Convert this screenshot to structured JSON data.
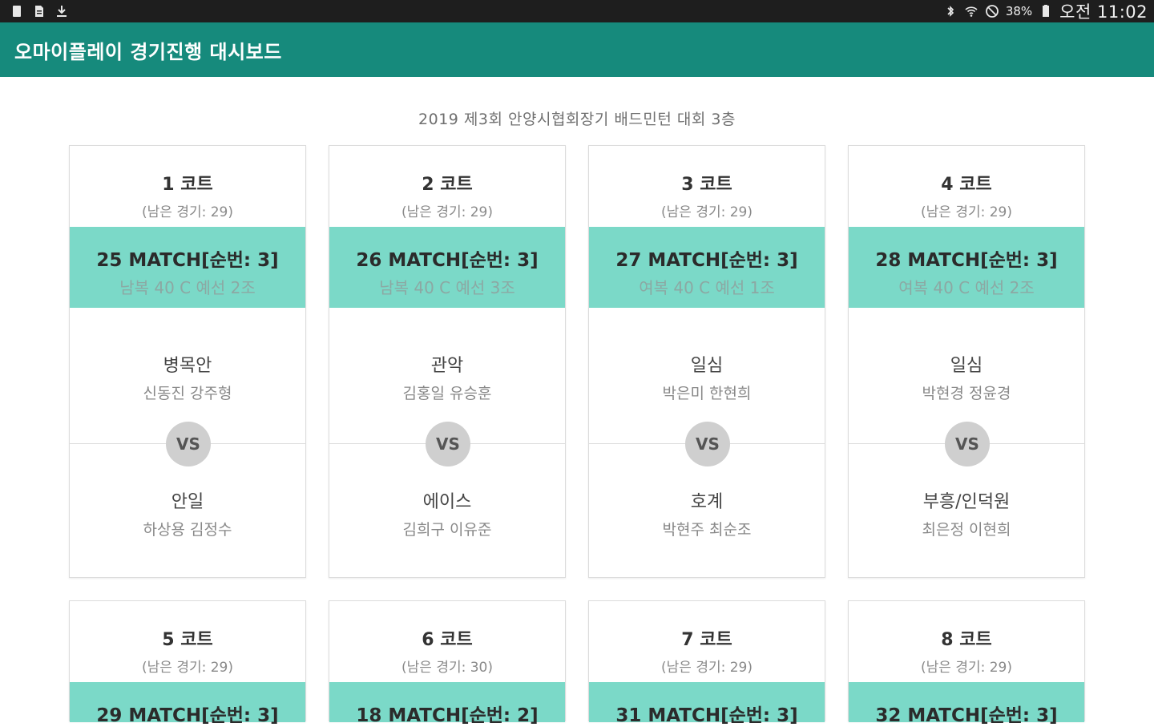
{
  "status_bar": {
    "left_icons": [
      "phone-storage-icon",
      "document-icon",
      "download-icon"
    ],
    "right_icons": [
      "bluetooth-icon",
      "wifi-icon",
      "do-not-disturb-icon",
      "battery-icon"
    ],
    "battery": "38%",
    "time": "오전 11:02"
  },
  "app_bar": {
    "title": "오마이플레이 경기진행 대시보드",
    "color": "#168a7c"
  },
  "event": {
    "title": "2019 제3회 안양시협회장기 배드민턴 대회 3층"
  },
  "colors": {
    "match_bar": "#7bd9c8",
    "vs_badge": "#cfcfcf"
  },
  "courts": [
    {
      "name": "1 코트",
      "remaining": "(남은 경기: 29)",
      "match_title": "25 MATCH[순번: 3]",
      "match_desc": "남복 40 C 예선 2조",
      "team_a": {
        "name": "병목안",
        "players": "신동진 강주형"
      },
      "vs": "VS",
      "team_b": {
        "name": "안일",
        "players": "하상용 김정수"
      }
    },
    {
      "name": "2 코트",
      "remaining": "(남은 경기: 29)",
      "match_title": "26 MATCH[순번: 3]",
      "match_desc": "남복 40 C 예선 3조",
      "team_a": {
        "name": "관악",
        "players": "김홍일 유승훈"
      },
      "vs": "VS",
      "team_b": {
        "name": "에이스",
        "players": "김희구 이유준"
      }
    },
    {
      "name": "3 코트",
      "remaining": "(남은 경기: 29)",
      "match_title": "27 MATCH[순번: 3]",
      "match_desc": "여복 40 C 예선 1조",
      "team_a": {
        "name": "일심",
        "players": "박은미 한현희"
      },
      "vs": "VS",
      "team_b": {
        "name": "호계",
        "players": "박현주 최순조"
      }
    },
    {
      "name": "4 코트",
      "remaining": "(남은 경기: 29)",
      "match_title": "28 MATCH[순번: 3]",
      "match_desc": "여복 40 C 예선 2조",
      "team_a": {
        "name": "일심",
        "players": "박현경 정윤경"
      },
      "vs": "VS",
      "team_b": {
        "name": "부흥/인덕원",
        "players": "최은정 이현희"
      }
    },
    {
      "name": "5 코트",
      "remaining": "(남은 경기: 29)",
      "match_title": "29 MATCH[순번: 3]"
    },
    {
      "name": "6 코트",
      "remaining": "(남은 경기: 30)",
      "match_title": "18 MATCH[순번: 2]"
    },
    {
      "name": "7 코트",
      "remaining": "(남은 경기: 29)",
      "match_title": "31 MATCH[순번: 3]"
    },
    {
      "name": "8 코트",
      "remaining": "(남은 경기: 29)",
      "match_title": "32 MATCH[순번: 3]"
    }
  ]
}
